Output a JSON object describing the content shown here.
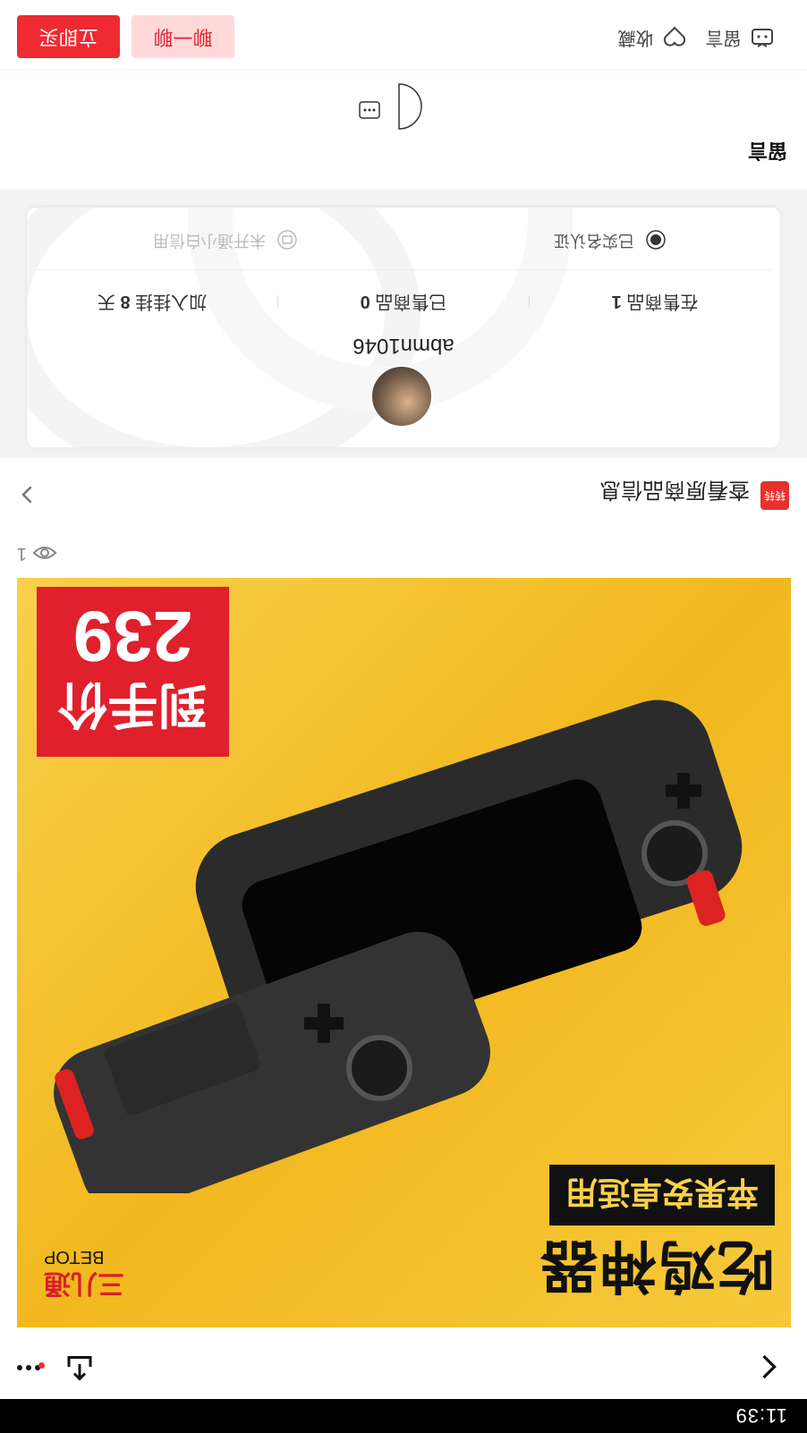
{
  "status_bar": {
    "time": "11:39"
  },
  "nav": {
    "back": "back",
    "share": "share",
    "more": "more"
  },
  "product_image": {
    "title": "吃鸡神器",
    "subtitle": "苹果安卓适用",
    "price_label": "到手价",
    "price_value": "239",
    "brand": "三儿通",
    "brand_sub": "BETOP"
  },
  "views": {
    "count": "1"
  },
  "source": {
    "label": "查看原商品信息",
    "logo_text": "转转"
  },
  "seller": {
    "name": "abmn1046",
    "stats": [
      {
        "label": "在售商品",
        "value": "1"
      },
      {
        "label": "已售商品",
        "value": "0"
      },
      {
        "label": "加入挂挂",
        "value": "8",
        "suffix": "天"
      }
    ],
    "certs": [
      {
        "label": "已实名认证",
        "color": "#333333"
      },
      {
        "label": "未开通小白信用",
        "color": "#bbbbbb"
      }
    ]
  },
  "comments": {
    "title": "留言"
  },
  "bottom_bar": {
    "comment_label": "留言",
    "favorite_label": "收藏",
    "chat_button": "聊一聊",
    "buy_button": "立即买"
  },
  "colors": {
    "accent": "#ef2a33",
    "accent_light": "#ffd9d9",
    "image_bg": "#f2b81f"
  }
}
